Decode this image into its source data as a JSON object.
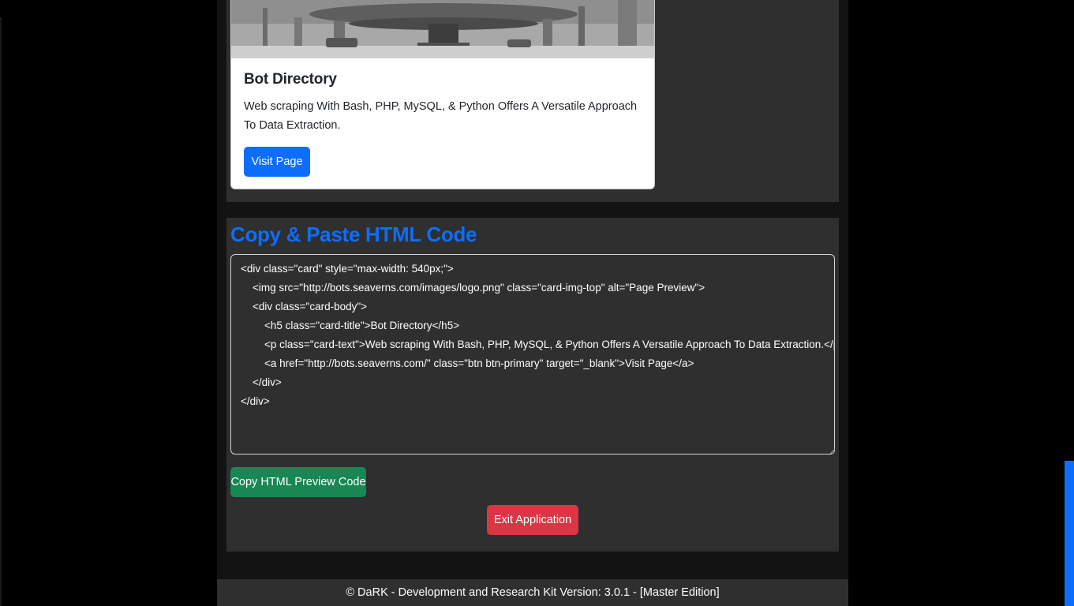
{
  "card": {
    "title": "Bot Directory",
    "text": "Web scraping With Bash, PHP, MySQL, & Python Offers A Versatile Approach To Data Extraction.",
    "button_label": "Visit Page"
  },
  "code_section": {
    "heading": "Copy & Paste HTML Code",
    "code": "<div class=\"card\" style=\"max-width: 540px;\">\n    <img src=\"http://bots.seaverns.com/images/logo.png\" class=\"card-img-top\" alt=\"Page Preview\">\n    <div class=\"card-body\">\n        <h5 class=\"card-title\">Bot Directory</h5>\n        <p class=\"card-text\">Web scraping With Bash, PHP, MySQL, & Python Offers A Versatile Approach To Data Extraction.</p>\n        <a href=\"http://bots.seaverns.com/\" class=\"btn btn-primary\" target=\"_blank\">Visit Page</a>\n    </div>\n</div>",
    "copy_button_label": "Copy HTML Preview Code",
    "exit_button_label": "Exit Application"
  },
  "footer": {
    "text": "© DaRK - Development and Research Kit Version: 3.0.1 - [Master Edition]"
  },
  "colors": {
    "primary": "#0d6efd",
    "success": "#198754",
    "danger": "#dc3545",
    "panel": "#2f2f2f",
    "background": "#000000"
  }
}
